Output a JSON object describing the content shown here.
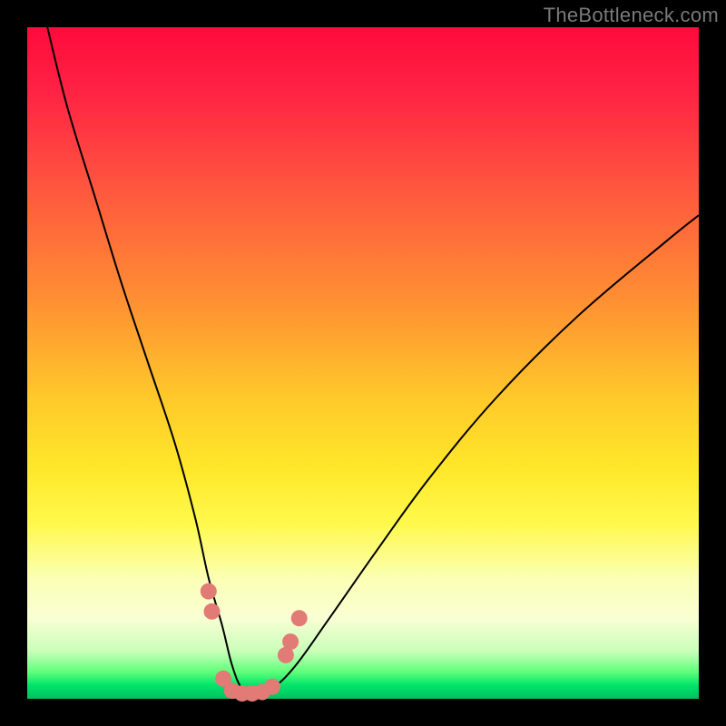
{
  "watermark": "TheBottleneck.com",
  "chart_data": {
    "type": "line",
    "title": "",
    "xlabel": "",
    "ylabel": "",
    "xlim": [
      0,
      100
    ],
    "ylim": [
      0,
      100
    ],
    "series": [
      {
        "name": "bottleneck-curve",
        "x": [
          3,
          6,
          10,
          14,
          18,
          22,
          25,
          27,
          29,
          30.5,
          32,
          34,
          36.5,
          40,
          45,
          52,
          60,
          70,
          82,
          95,
          100
        ],
        "values": [
          100,
          88,
          75,
          62,
          50,
          38,
          27,
          18,
          11,
          5,
          1.5,
          0.5,
          1.5,
          5,
          12,
          22,
          33,
          45,
          57,
          68,
          72
        ]
      }
    ],
    "markers": {
      "name": "highlight-points",
      "color": "#e27a76",
      "points": [
        {
          "x": 27.0,
          "y": 16.0
        },
        {
          "x": 27.5,
          "y": 13.0
        },
        {
          "x": 29.2,
          "y": 3.0
        },
        {
          "x": 30.5,
          "y": 1.2
        },
        {
          "x": 32.0,
          "y": 0.8
        },
        {
          "x": 33.5,
          "y": 0.8
        },
        {
          "x": 35.0,
          "y": 1.0
        },
        {
          "x": 36.5,
          "y": 1.8
        },
        {
          "x": 38.5,
          "y": 6.5
        },
        {
          "x": 39.2,
          "y": 8.5
        },
        {
          "x": 40.5,
          "y": 12.0
        }
      ]
    },
    "gradient_stops": [
      {
        "pos": 0.0,
        "color": "#ff0a3c"
      },
      {
        "pos": 0.1,
        "color": "#ff2444"
      },
      {
        "pos": 0.25,
        "color": "#ff5a3e"
      },
      {
        "pos": 0.4,
        "color": "#ff8d33"
      },
      {
        "pos": 0.55,
        "color": "#ffc82a"
      },
      {
        "pos": 0.66,
        "color": "#ffe82a"
      },
      {
        "pos": 0.74,
        "color": "#fff94d"
      },
      {
        "pos": 0.82,
        "color": "#fbffb4"
      },
      {
        "pos": 0.88,
        "color": "#f9ffd4"
      },
      {
        "pos": 0.93,
        "color": "#c8ffb8"
      },
      {
        "pos": 0.96,
        "color": "#5fff7a"
      },
      {
        "pos": 0.98,
        "color": "#00e46a"
      },
      {
        "pos": 1.0,
        "color": "#00c060"
      }
    ]
  }
}
